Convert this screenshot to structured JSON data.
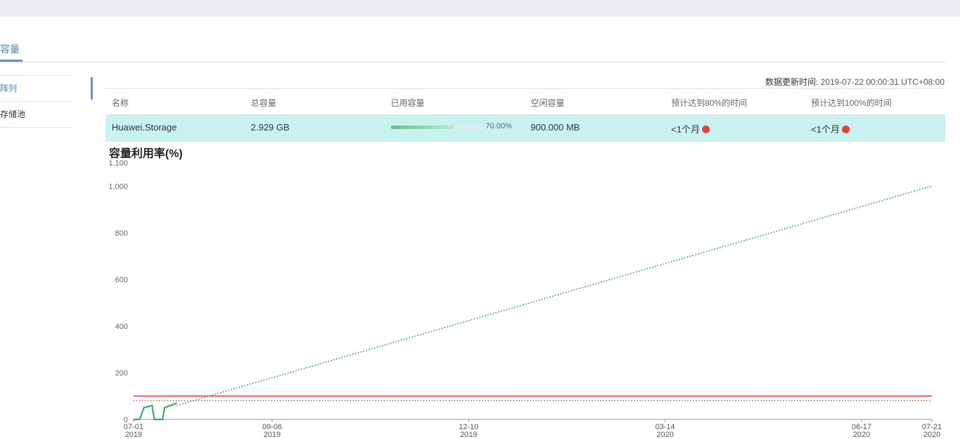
{
  "tabs": {
    "active_label": "容量"
  },
  "sidebar": {
    "items": [
      {
        "label": "阵列"
      },
      {
        "label": "存储池"
      }
    ]
  },
  "update": {
    "label": "数据更新时间:",
    "value": "2019-07-22 00:00:31 UTC+08:00"
  },
  "table": {
    "headers": [
      "名称",
      "总容量",
      "已用容量",
      "空闲容量",
      "预计达到80%的时间",
      "预计达到100%的时间"
    ],
    "rows": [
      {
        "name": "Huawei.Storage",
        "total": "2.929 GB",
        "used_percent_label": "70.00%",
        "used_fraction": 0.7,
        "free": "900.000 MB",
        "eta80": "<1个月",
        "eta100": "<1个月"
      }
    ]
  },
  "chart_title": "容量利用率(%)",
  "chart_data": {
    "type": "line",
    "ylim": [
      0,
      1100
    ],
    "yticks": [
      {
        "label": "0",
        "value": 0
      },
      {
        "label": "200",
        "value": 200
      },
      {
        "label": "400",
        "value": 400
      },
      {
        "label": "600",
        "value": 600
      },
      {
        "label": "800",
        "value": 800
      },
      {
        "label": "1,000",
        "value": 1000
      },
      {
        "label": "1,100",
        "value": 1100
      }
    ],
    "xlim": [
      "2019-07-01",
      "2020-07-21"
    ],
    "xticks": [
      {
        "date": "2019-07-01",
        "label": "07-01",
        "year": "2019"
      },
      {
        "date": "2019-09-06",
        "label": "09-06",
        "year": "2019"
      },
      {
        "date": "2019-12-10",
        "label": "12-10",
        "year": "2019"
      },
      {
        "date": "2020-03-14",
        "label": "03-14",
        "year": "2020"
      },
      {
        "date": "2020-06-17",
        "label": "06-17",
        "year": "2020"
      },
      {
        "date": "2020-07-21",
        "label": "07-21",
        "year": "2020"
      }
    ],
    "series": [
      {
        "style": "solid",
        "color": "#22b14c",
        "points": [
          [
            "2019-07-01",
            0
          ],
          [
            "2019-07-04",
            0
          ],
          [
            "2019-07-06",
            50
          ],
          [
            "2019-07-10",
            60
          ],
          [
            "2019-07-11",
            0
          ],
          [
            "2019-07-15",
            0
          ],
          [
            "2019-07-16",
            50
          ],
          [
            "2019-07-22",
            70
          ]
        ]
      },
      {
        "style": "dotted",
        "color": "#22a04a",
        "points": [
          [
            "2019-07-22",
            60
          ],
          [
            "2020-07-21",
            1000
          ]
        ]
      }
    ],
    "thresholds": [
      {
        "value": 100,
        "color": "#cc2222",
        "style": "solid"
      },
      {
        "value": 80,
        "color": "#dd3333",
        "style": "dotted"
      }
    ]
  }
}
